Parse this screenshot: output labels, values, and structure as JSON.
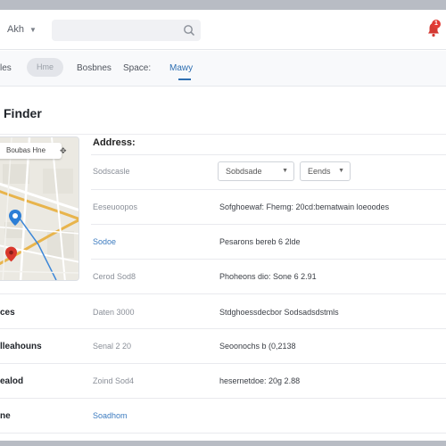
{
  "header": {
    "account_label": "Akh",
    "notification_count": "1"
  },
  "search": {
    "placeholder": ""
  },
  "nav": {
    "items": [
      {
        "label": "les"
      },
      {
        "label": "Hme"
      },
      {
        "label": "Bosbnes"
      },
      {
        "label": "Space:"
      },
      {
        "label": "Mawy"
      }
    ]
  },
  "page": {
    "title": "Finder"
  },
  "map": {
    "chip_label": "Boubas Hne"
  },
  "address": {
    "heading": "Address:",
    "select_1": "Sobdsade",
    "select_2": "Eends",
    "rows": [
      {
        "label": "Sodscasle",
        "value": ""
      },
      {
        "label": "Eeseuoopos",
        "value": "Sofghoewaf: Fhemg: 20cd:bematwain loeoodes"
      },
      {
        "label": "Sodoe",
        "value": "Pesarons bereb 6 2lde"
      },
      {
        "label": "Cerod Sod8",
        "value": "Phoheons dio: Sone 6 2.91"
      },
      {
        "label": "Daten 3000",
        "value": "Stdghoessdecbor Sodsadsdstmls"
      },
      {
        "label": "Senal 2 20",
        "value": "Seoonochs b (0,2138"
      },
      {
        "label": "Zoind Sod4",
        "value": "hesernetdoe: 20g 2.88"
      },
      {
        "label": "Soadhom",
        "value": ""
      }
    ]
  },
  "left_labels": [
    "ces",
    "lleahouns",
    "ealod",
    "ne"
  ],
  "colors": {
    "accent": "#2e6fb2",
    "badge": "#e23b35",
    "map_route": "#e8b44c",
    "map_pin_blue": "#2c7ed6",
    "map_pin_red": "#d9372b"
  }
}
